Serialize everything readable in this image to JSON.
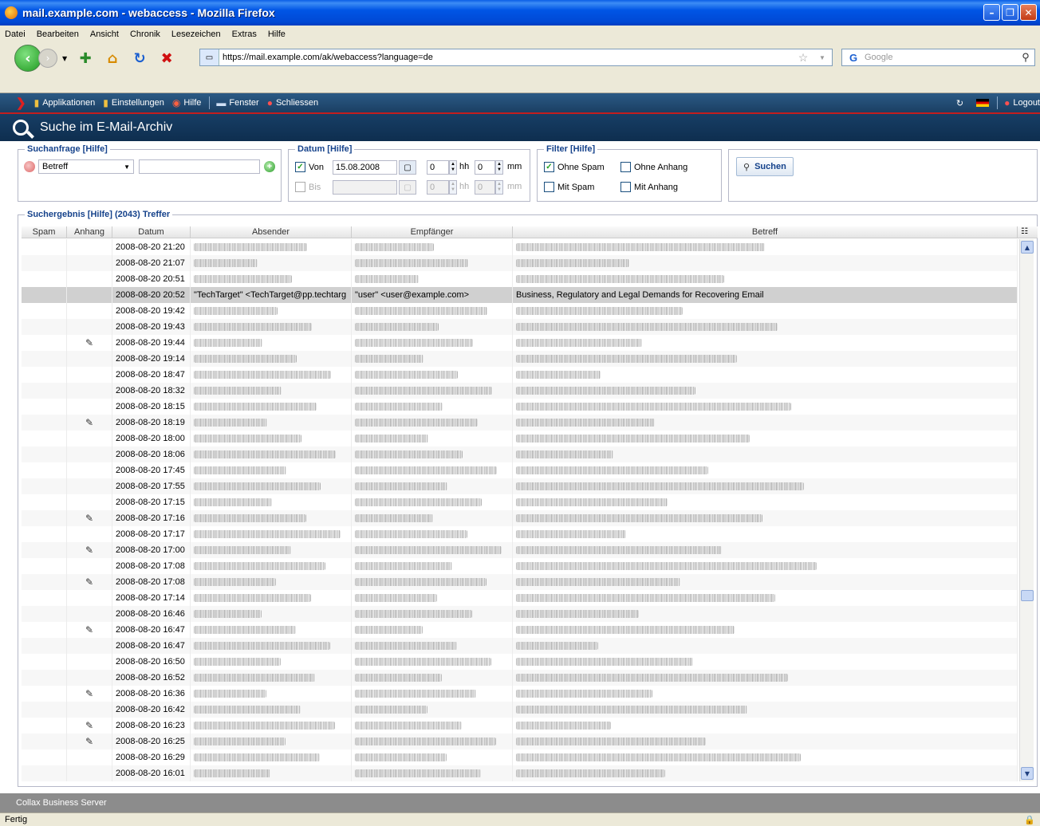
{
  "window": {
    "title": "mail.example.com - webaccess - Mozilla Firefox"
  },
  "menu": [
    "Datei",
    "Bearbeiten",
    "Ansicht",
    "Chronik",
    "Lesezeichen",
    "Extras",
    "Hilfe"
  ],
  "nav": {
    "url": "https://mail.example.com/ak/webaccess?language=de",
    "search_placeholder": "Google"
  },
  "apptoolbar": {
    "items": [
      "Applikationen",
      "Einstellungen",
      "Hilfe",
      "Fenster",
      "Schliessen"
    ],
    "logout": "Logout"
  },
  "page": {
    "title": "Suche im E-Mail-Archiv"
  },
  "query": {
    "legend": "Suchanfrage [Hilfe]",
    "field": "Betreff",
    "value": ""
  },
  "date": {
    "legend": "Datum [Hilfe]",
    "from_label": "Von",
    "from_date": "15.08.2008",
    "from_hh": "0",
    "from_mm": "0",
    "to_label": "Bis",
    "to_date": "",
    "to_hh": "0",
    "to_mm": "0",
    "hh_label": "hh",
    "mm_label": "mm"
  },
  "filter": {
    "legend": "Filter [Hilfe]",
    "ohne_spam": "Ohne Spam",
    "ohne_anhang": "Ohne Anhang",
    "mit_spam": "Mit Spam",
    "mit_anhang": "Mit Anhang"
  },
  "search_button": "Suchen",
  "results": {
    "legend": "Suchergebnis [Hilfe] (2043) Treffer",
    "columns": [
      "Spam",
      "Anhang",
      "Datum",
      "Absender",
      "Empfänger",
      "Betreff"
    ],
    "rows": [
      {
        "date": "2008-08-20 21:20",
        "att": false
      },
      {
        "date": "2008-08-20 21:07",
        "att": false
      },
      {
        "date": "2008-08-20 20:51",
        "att": false
      },
      {
        "date": "2008-08-20 20:52",
        "att": false,
        "selected": true,
        "sender": "\"TechTarget\" <TechTarget@pp.techtarg",
        "recipient": "\"user\" <user@example.com>",
        "subject": "Business, Regulatory and Legal Demands for Recovering Email"
      },
      {
        "date": "2008-08-20 19:42",
        "att": false
      },
      {
        "date": "2008-08-20 19:43",
        "att": false
      },
      {
        "date": "2008-08-20 19:44",
        "att": true
      },
      {
        "date": "2008-08-20 19:14",
        "att": false
      },
      {
        "date": "2008-08-20 18:47",
        "att": false
      },
      {
        "date": "2008-08-20 18:32",
        "att": false
      },
      {
        "date": "2008-08-20 18:15",
        "att": false
      },
      {
        "date": "2008-08-20 18:19",
        "att": true
      },
      {
        "date": "2008-08-20 18:00",
        "att": false
      },
      {
        "date": "2008-08-20 18:06",
        "att": false
      },
      {
        "date": "2008-08-20 17:45",
        "att": false
      },
      {
        "date": "2008-08-20 17:55",
        "att": false
      },
      {
        "date": "2008-08-20 17:15",
        "att": false
      },
      {
        "date": "2008-08-20 17:16",
        "att": true
      },
      {
        "date": "2008-08-20 17:17",
        "att": false
      },
      {
        "date": "2008-08-20 17:00",
        "att": true
      },
      {
        "date": "2008-08-20 17:08",
        "att": false
      },
      {
        "date": "2008-08-20 17:08",
        "att": true
      },
      {
        "date": "2008-08-20 17:14",
        "att": false
      },
      {
        "date": "2008-08-20 16:46",
        "att": false
      },
      {
        "date": "2008-08-20 16:47",
        "att": true
      },
      {
        "date": "2008-08-20 16:47",
        "att": false
      },
      {
        "date": "2008-08-20 16:50",
        "att": false
      },
      {
        "date": "2008-08-20 16:52",
        "att": false
      },
      {
        "date": "2008-08-20 16:36",
        "att": true
      },
      {
        "date": "2008-08-20 16:42",
        "att": false
      },
      {
        "date": "2008-08-20 16:23",
        "att": true
      },
      {
        "date": "2008-08-20 16:25",
        "att": true
      },
      {
        "date": "2008-08-20 16:29",
        "att": false
      },
      {
        "date": "2008-08-20 16:01",
        "att": false
      }
    ]
  },
  "footer": "Collax Business Server",
  "status": "Fertig"
}
